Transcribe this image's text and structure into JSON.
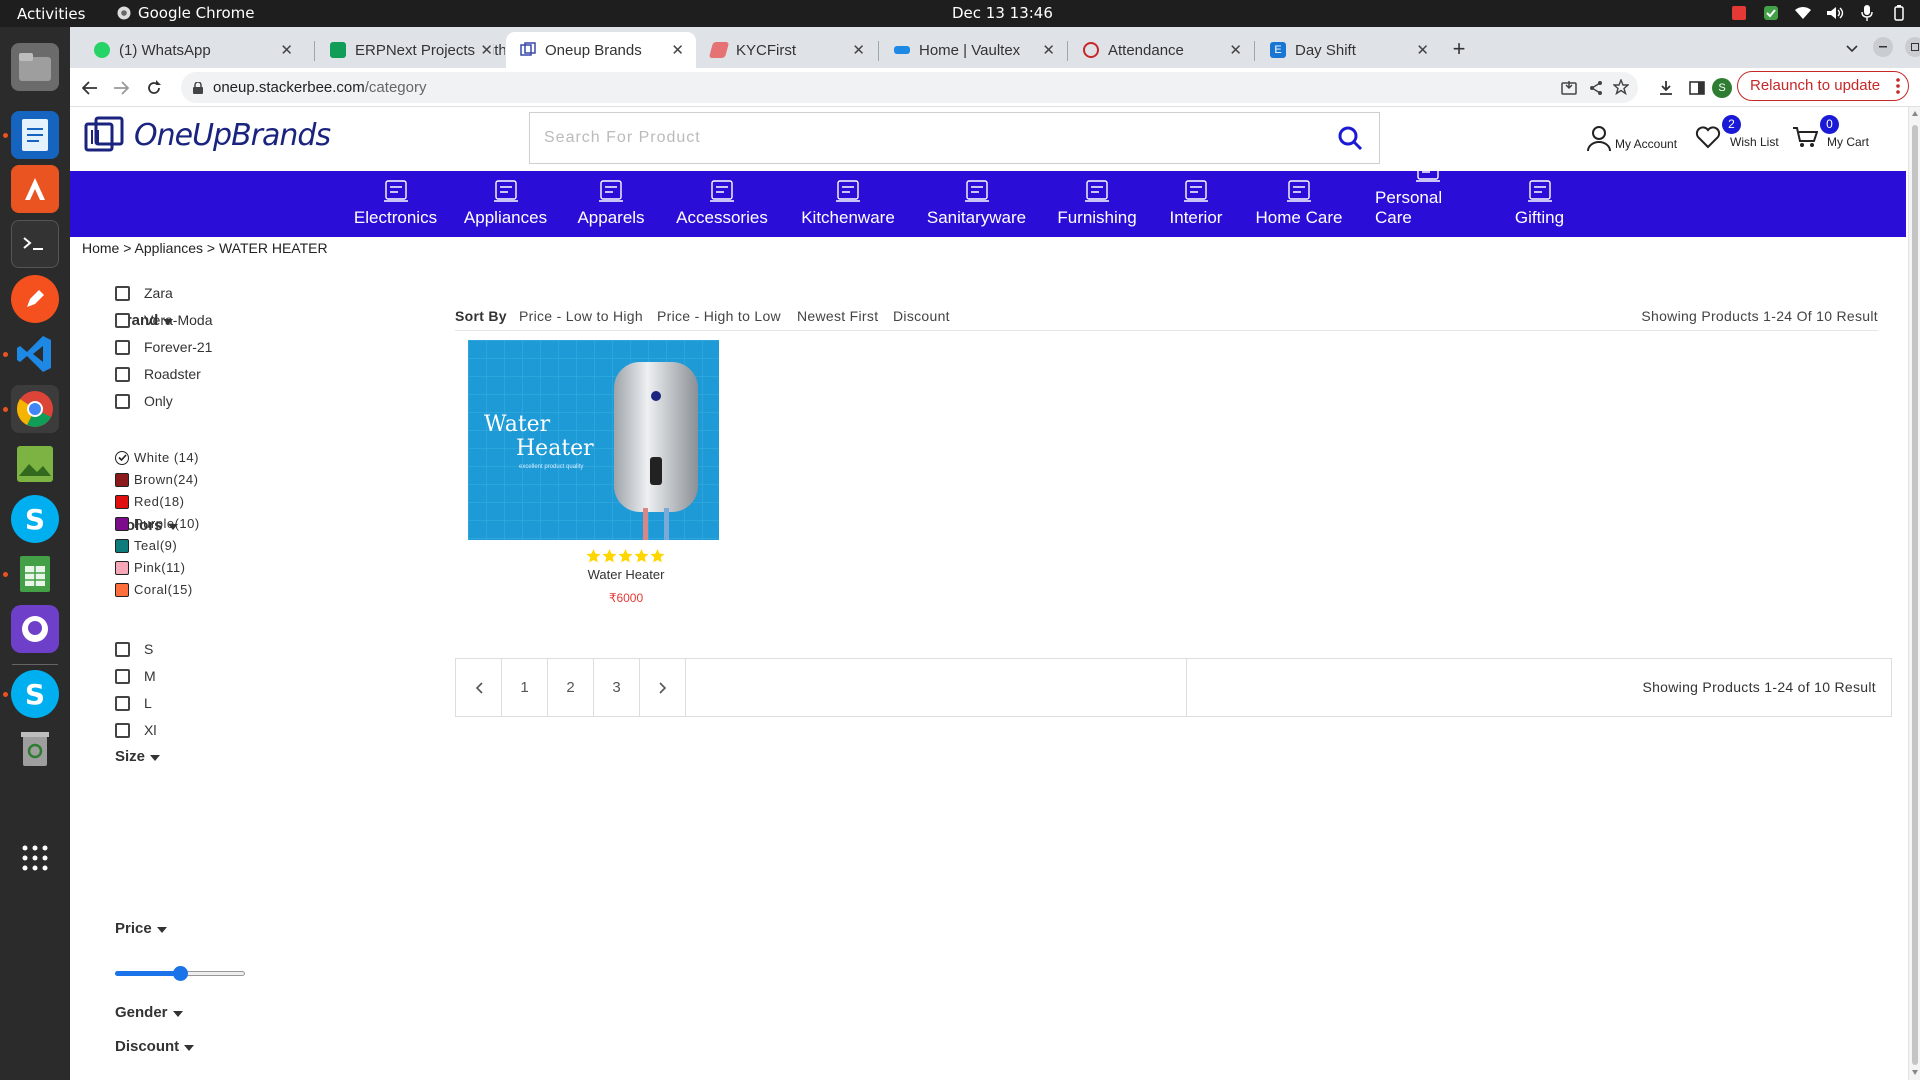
{
  "system": {
    "activities": "Activities",
    "app_name": "Google Chrome",
    "clock": "Dec 13  13:46"
  },
  "browser": {
    "tabs": [
      {
        "label": "(1) WhatsApp",
        "icon": "whatsapp-icon",
        "color": "#25d366"
      },
      {
        "label": "ERPNext Projects Githu",
        "icon": "sheets-icon",
        "color": "#0f9d58"
      },
      {
        "label": "Oneup Brands",
        "icon": "oneup-icon",
        "color": "#3949ab"
      },
      {
        "label": "KYCFirst",
        "icon": "kyc-icon",
        "color": "#e57373"
      },
      {
        "label": "Home | Vaultex",
        "icon": "vaultex-icon",
        "color": "#1e88e5"
      },
      {
        "label": "Attendance",
        "icon": "attendance-icon",
        "color": "#c62828"
      },
      {
        "label": "Day Shift",
        "icon": "dayshift-icon",
        "color": "#1976d2"
      }
    ],
    "url_host": "oneup.stackerbee.com",
    "url_path": "/category",
    "relaunch": "Relaunch to update",
    "profile_initial": "S"
  },
  "site": {
    "logo_text": "OneUpBrands",
    "search_placeholder": "Search For Product",
    "my_account": "My Account",
    "wish_list": "Wish List",
    "wish_count": "2",
    "my_cart": "My Cart",
    "cart_count": "0",
    "categories": [
      "Electronics",
      "Appliances",
      "Apparels",
      "Accessories",
      "Kitchenware",
      "Sanitaryware",
      "Furnishing",
      "Interior",
      "Home Care",
      "Personal Care",
      "Gifting"
    ],
    "breadcrumb": "Home > Appliances > WATER HEATER"
  },
  "filters": {
    "brand_title": "Brand",
    "brands": [
      "Zara",
      "Vera-Moda",
      "Forever-21",
      "Roadster",
      "Only"
    ],
    "colors_title": "Colors",
    "colors": [
      {
        "label": "White (14)",
        "hex": "#ffffff",
        "checked": true
      },
      {
        "label": "Brown(24)",
        "hex": "#8b1a1a"
      },
      {
        "label": "Red(18)",
        "hex": "#e01010"
      },
      {
        "label": "Purple(10)",
        "hex": "#7b0c8a"
      },
      {
        "label": "Teal(9)",
        "hex": "#0e7c7b"
      },
      {
        "label": "Pink(11)",
        "hex": "#f7a8b8"
      },
      {
        "label": "Coral(15)",
        "hex": "#ff6f3c"
      }
    ],
    "size_title": "Size",
    "sizes": [
      "S",
      "M",
      "L",
      "Xl"
    ],
    "price_title": "Price",
    "price_slider_fraction": 0.5,
    "gender_title": "Gender",
    "discount_title": "Discount"
  },
  "listing": {
    "sort_label": "Sort By",
    "sort_options": [
      "Price - Low to High",
      "Price - High to Low",
      "Newest First",
      "Discount"
    ],
    "showing_top": "Showing Products 1-24 Of 10 Result",
    "product": {
      "image_title_line1": "Water",
      "image_title_line2": "Heater",
      "image_tagline": "excellent product quality",
      "rating": 5,
      "name": "Water Heater",
      "price": "₹6000"
    },
    "pages": [
      "1",
      "2",
      "3"
    ],
    "showing_bottom": "Showing Products 1-24 of 10 Result"
  }
}
